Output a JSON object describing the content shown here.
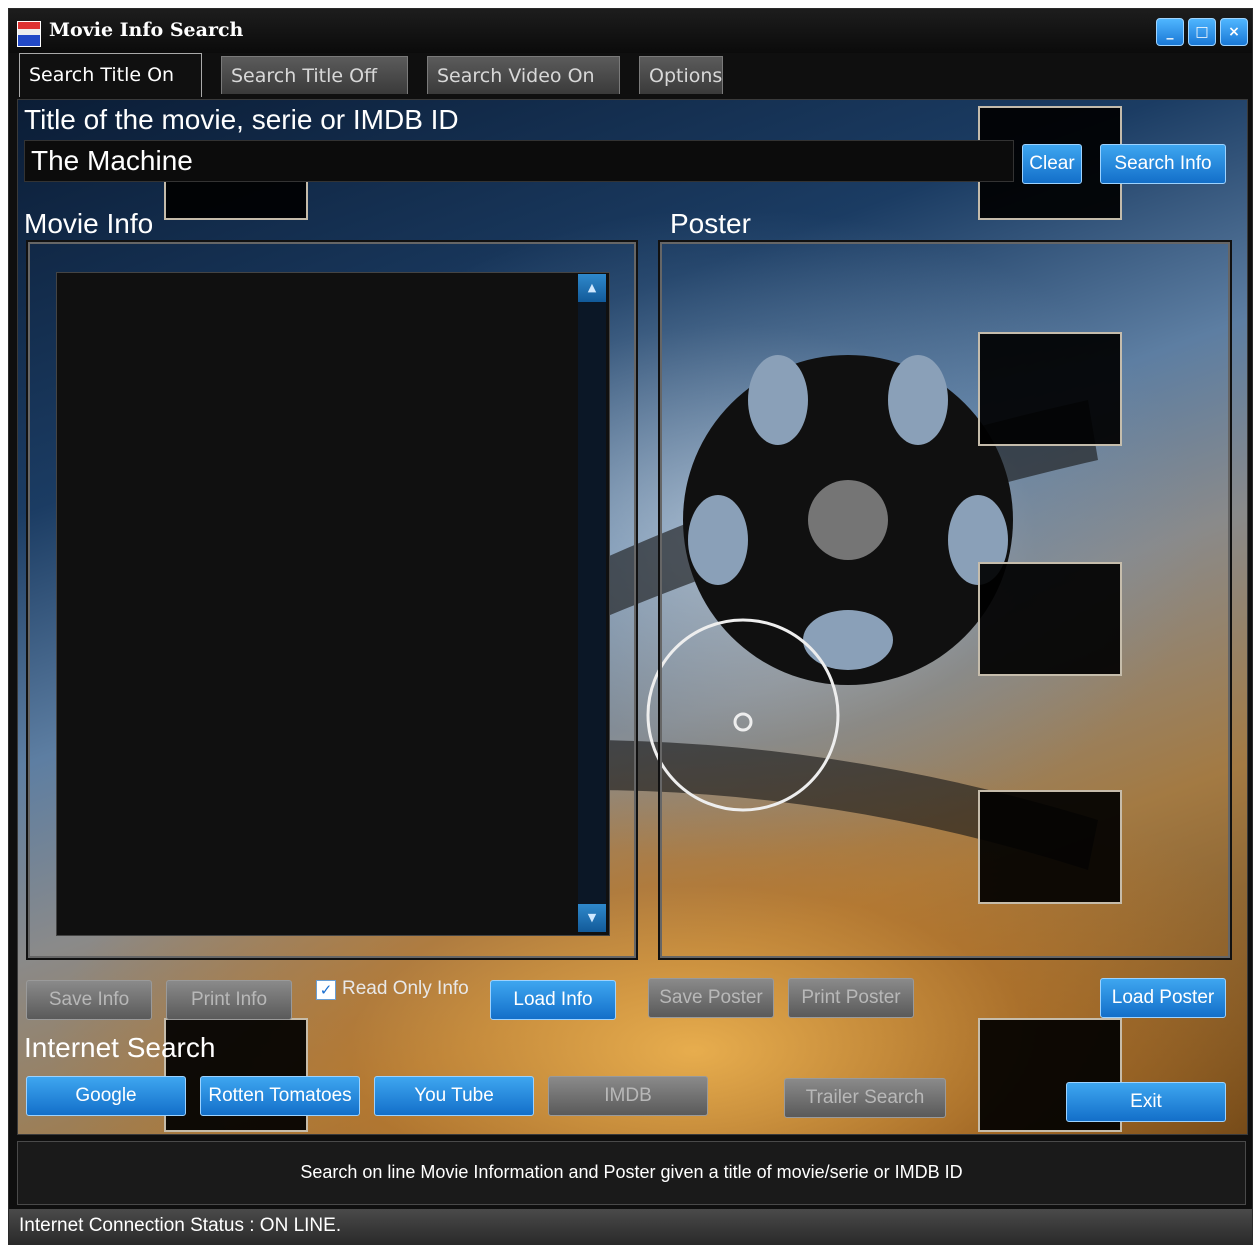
{
  "window": {
    "title": "Movie Info Search",
    "controls": {
      "minimize": "_",
      "maximize": "□",
      "close": "×"
    }
  },
  "tabs": [
    {
      "label": "Search Title On Line",
      "active": true
    },
    {
      "label": "Search Title Off Line",
      "active": false
    },
    {
      "label": "Search Video On Line",
      "active": false
    },
    {
      "label": "Options",
      "active": false
    }
  ],
  "search": {
    "label": "Title of the movie, serie or IMDB ID",
    "value": "The Machine",
    "clear_label": "Clear",
    "search_label": "Search Info"
  },
  "movie_info": {
    "heading": "Movie Info",
    "text": "",
    "save_label": "Save Info",
    "print_label": "Print Info",
    "readonly_label": "Read Only Info",
    "readonly_checked": true,
    "load_label": "Load Info"
  },
  "poster": {
    "heading": "Poster",
    "save_label": "Save Poster",
    "print_label": "Print Poster",
    "load_label": "Load Poster"
  },
  "internet_search": {
    "heading": "Internet Search",
    "google": "Google",
    "rotten": "Rotten Tomatoes",
    "youtube": "You Tube",
    "imdb": "IMDB",
    "trailer": "Trailer Search"
  },
  "exit_label": "Exit",
  "status_message": "Search on line Movie Information and Poster given a title of movie/serie or IMDB ID",
  "connection_status": "Internet Connection Status : ON LINE.",
  "colors": {
    "accent": "#1a78d6",
    "disabled": "#6a6a6a",
    "background": "#0f0f0f"
  }
}
